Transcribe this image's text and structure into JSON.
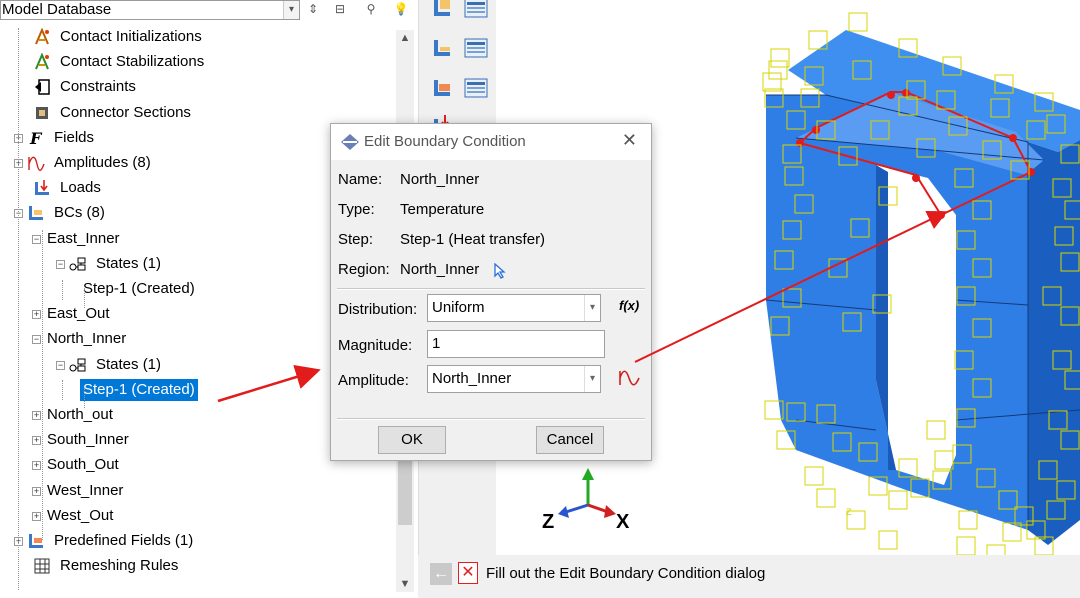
{
  "model_tree": {
    "database_label": "Model Database",
    "items": [
      {
        "label": "Contact Initializations",
        "icon": "contact-init-icon"
      },
      {
        "label": "Contact Stabilizations",
        "icon": "contact-stab-icon"
      },
      {
        "label": "Constraints",
        "icon": "constraints-icon"
      },
      {
        "label": "Connector Sections",
        "icon": "connector-sections-icon"
      },
      {
        "label": "Fields",
        "icon": "fields-icon"
      },
      {
        "label": "Amplitudes (8)",
        "icon": "amplitude-icon"
      },
      {
        "label": "Loads",
        "icon": "loads-icon"
      },
      {
        "label": "BCs (8)",
        "icon": "bcs-icon"
      },
      {
        "label": "East_Inner",
        "icon": ""
      },
      {
        "label": "States (1)",
        "icon": "states-icon"
      },
      {
        "label": "Step-1 (Created)",
        "icon": ""
      },
      {
        "label": "East_Out",
        "icon": ""
      },
      {
        "label": "North_Inner",
        "icon": ""
      },
      {
        "label": "States (1)",
        "icon": "states-icon"
      },
      {
        "label": "Step-1 (Created)",
        "icon": "",
        "selected": true
      },
      {
        "label": "North_out",
        "icon": ""
      },
      {
        "label": "South_Inner",
        "icon": ""
      },
      {
        "label": "South_Out",
        "icon": ""
      },
      {
        "label": "West_Inner",
        "icon": ""
      },
      {
        "label": "West_Out",
        "icon": ""
      },
      {
        "label": "Predefined Fields (1)",
        "icon": "predefined-fields-icon"
      },
      {
        "label": "Remeshing Rules",
        "icon": "remeshing-icon"
      }
    ]
  },
  "dialog": {
    "title": "Edit Boundary Condition",
    "name_key": "Name:",
    "name_value": "North_Inner",
    "type_key": "Type:",
    "type_value": "Temperature",
    "step_key": "Step:",
    "step_value": "Step-1 (Heat transfer)",
    "region_key": "Region:",
    "region_value": "North_Inner",
    "distribution_label": "Distribution:",
    "distribution_value": "Uniform",
    "fx_label": "f(x)",
    "magnitude_label": "Magnitude:",
    "magnitude_value": "1",
    "amplitude_label": "Amplitude:",
    "amplitude_value": "North_Inner",
    "ok_label": "OK",
    "cancel_label": "Cancel"
  },
  "prompt": {
    "text": "Fill out the Edit Boundary Condition dialog"
  },
  "triad": {
    "z": "Z",
    "x": "X"
  },
  "colors": {
    "selection": "#0078d7",
    "model_blue": "#2a7ee0",
    "annotation_red": "#e21b1b",
    "bc_marker": "#d4d400"
  }
}
